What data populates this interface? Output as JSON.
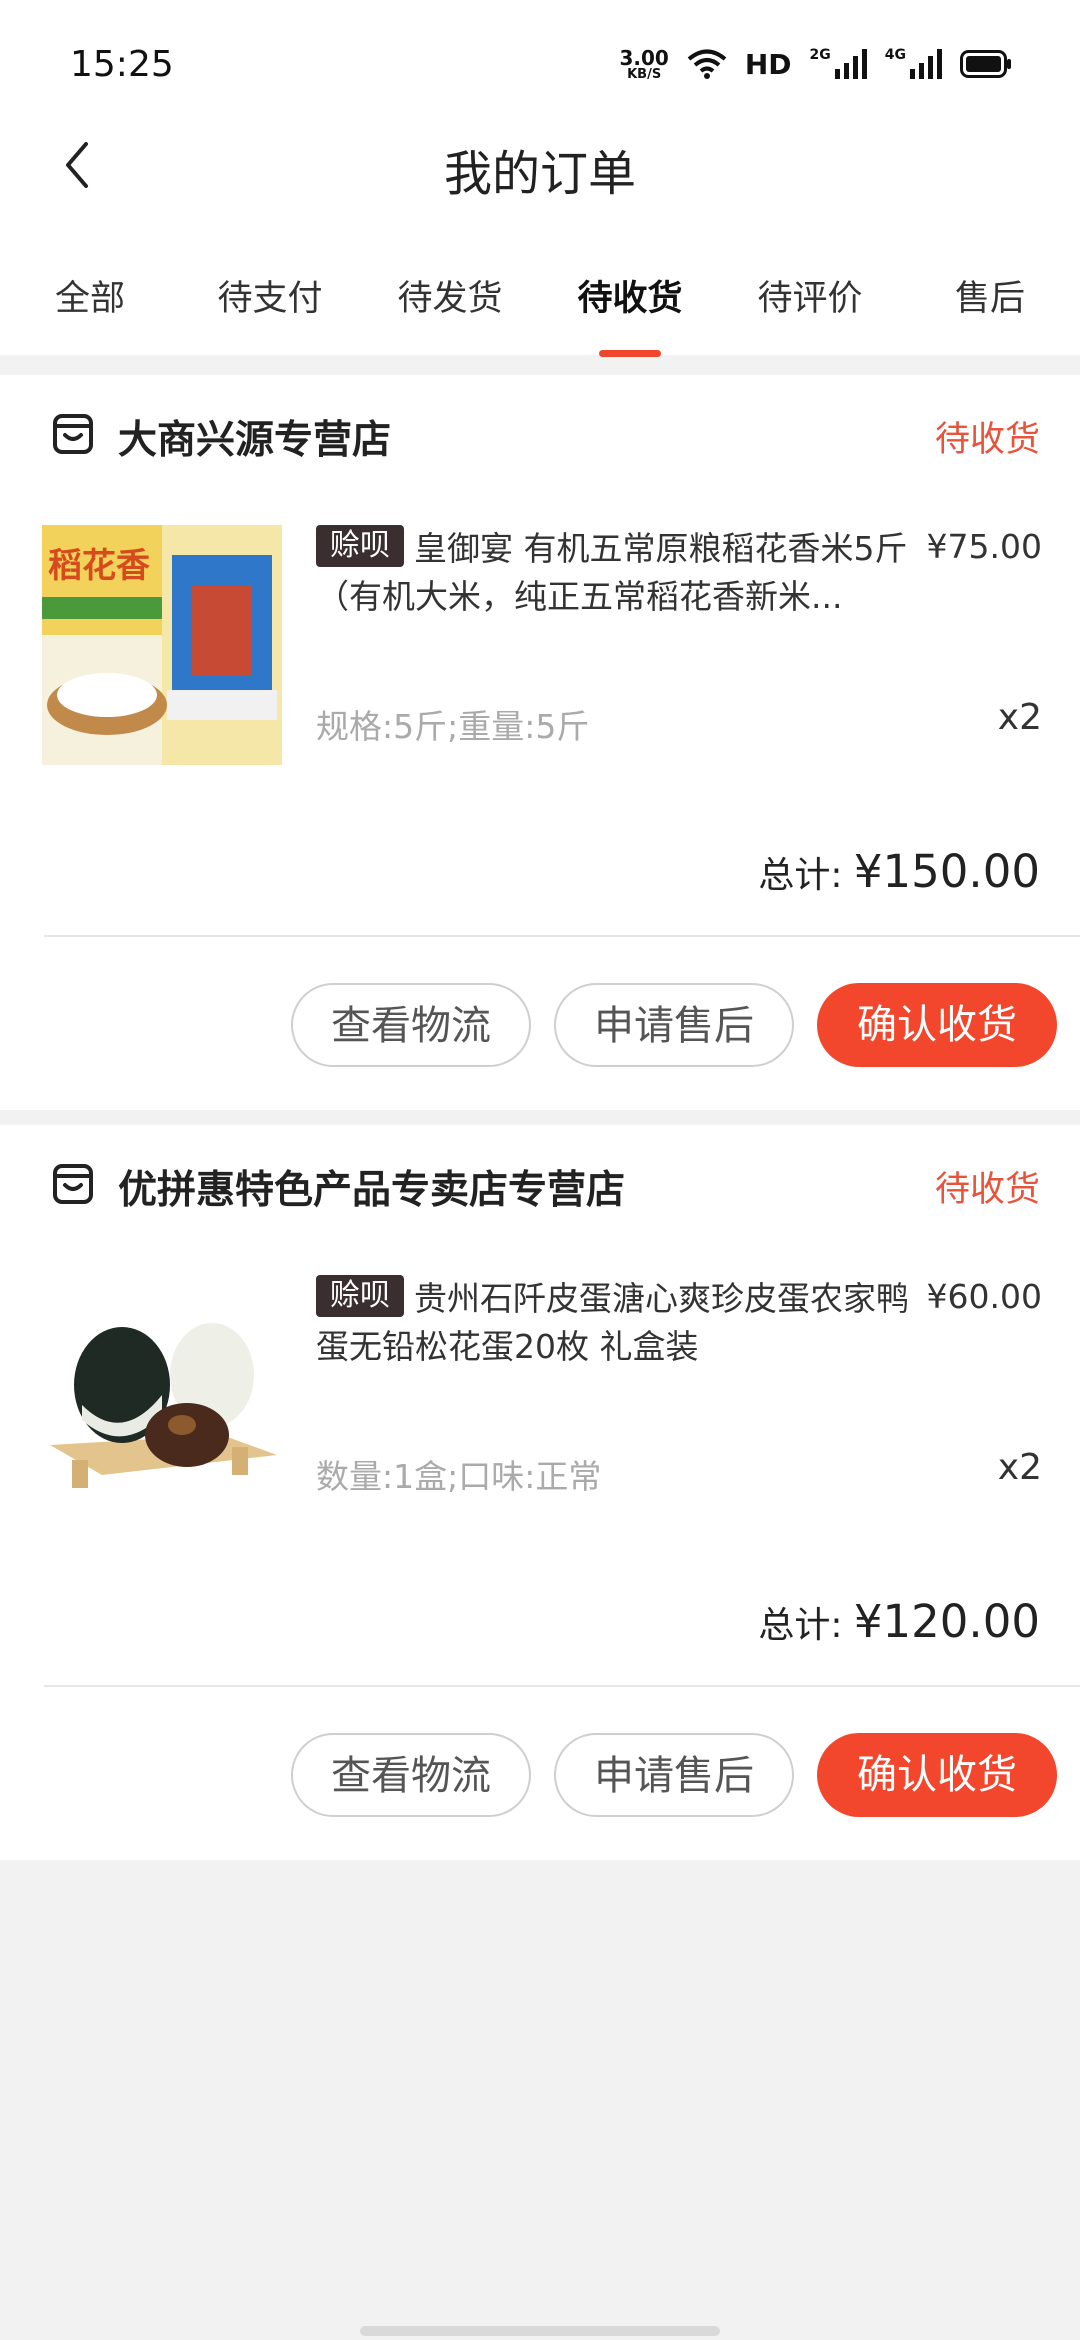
{
  "status_bar": {
    "time": "15:25",
    "net_speed": "3.00",
    "net_speed_unit": "KB/S",
    "hd_label": "HD",
    "net1": "2G",
    "net2": "4G"
  },
  "header": {
    "title": "我的订单"
  },
  "tabs": [
    {
      "label": "全部"
    },
    {
      "label": "待支付"
    },
    {
      "label": "待发货"
    },
    {
      "label": "待收货",
      "active": true
    },
    {
      "label": "待评价"
    },
    {
      "label": "售后"
    }
  ],
  "orders": [
    {
      "store": "大商兴源专营店",
      "status": "待收货",
      "badge": "赊呗",
      "title": "皇御宴 有机五常原粮稻花香米5斤（有机大米，纯正五常稻花香新米...",
      "price": "¥75.00",
      "spec": "规格:5斤;重量:5斤",
      "qty": "x2",
      "total_label": "总计:",
      "total": "¥150.00",
      "image_text": "稻花香",
      "buttons": {
        "logistics": "查看物流",
        "after_sale": "申请售后",
        "confirm": "确认收货"
      }
    },
    {
      "store": "优拼惠特色产品专卖店专营店",
      "status": "待收货",
      "badge": "赊呗",
      "title": "贵州石阡皮蛋溏心爽珍皮蛋农家鸭蛋无铅松花蛋20枚 礼盒装",
      "price": "¥60.00",
      "spec": "数量:1盒;口味:正常",
      "qty": "x2",
      "total_label": "总计:",
      "total": "¥120.00",
      "buttons": {
        "logistics": "查看物流",
        "after_sale": "申请售后",
        "confirm": "确认收货"
      }
    }
  ],
  "colors": {
    "accent": "#f2472d",
    "status_text": "#e8533c",
    "badge_bg": "#3a2e2e",
    "page_bg": "#f2f2f2"
  },
  "icons": {
    "back": "chevron-left-icon",
    "store": "store-icon",
    "wifi": "wifi-icon",
    "signal": "signal-icon",
    "battery": "battery-icon"
  }
}
